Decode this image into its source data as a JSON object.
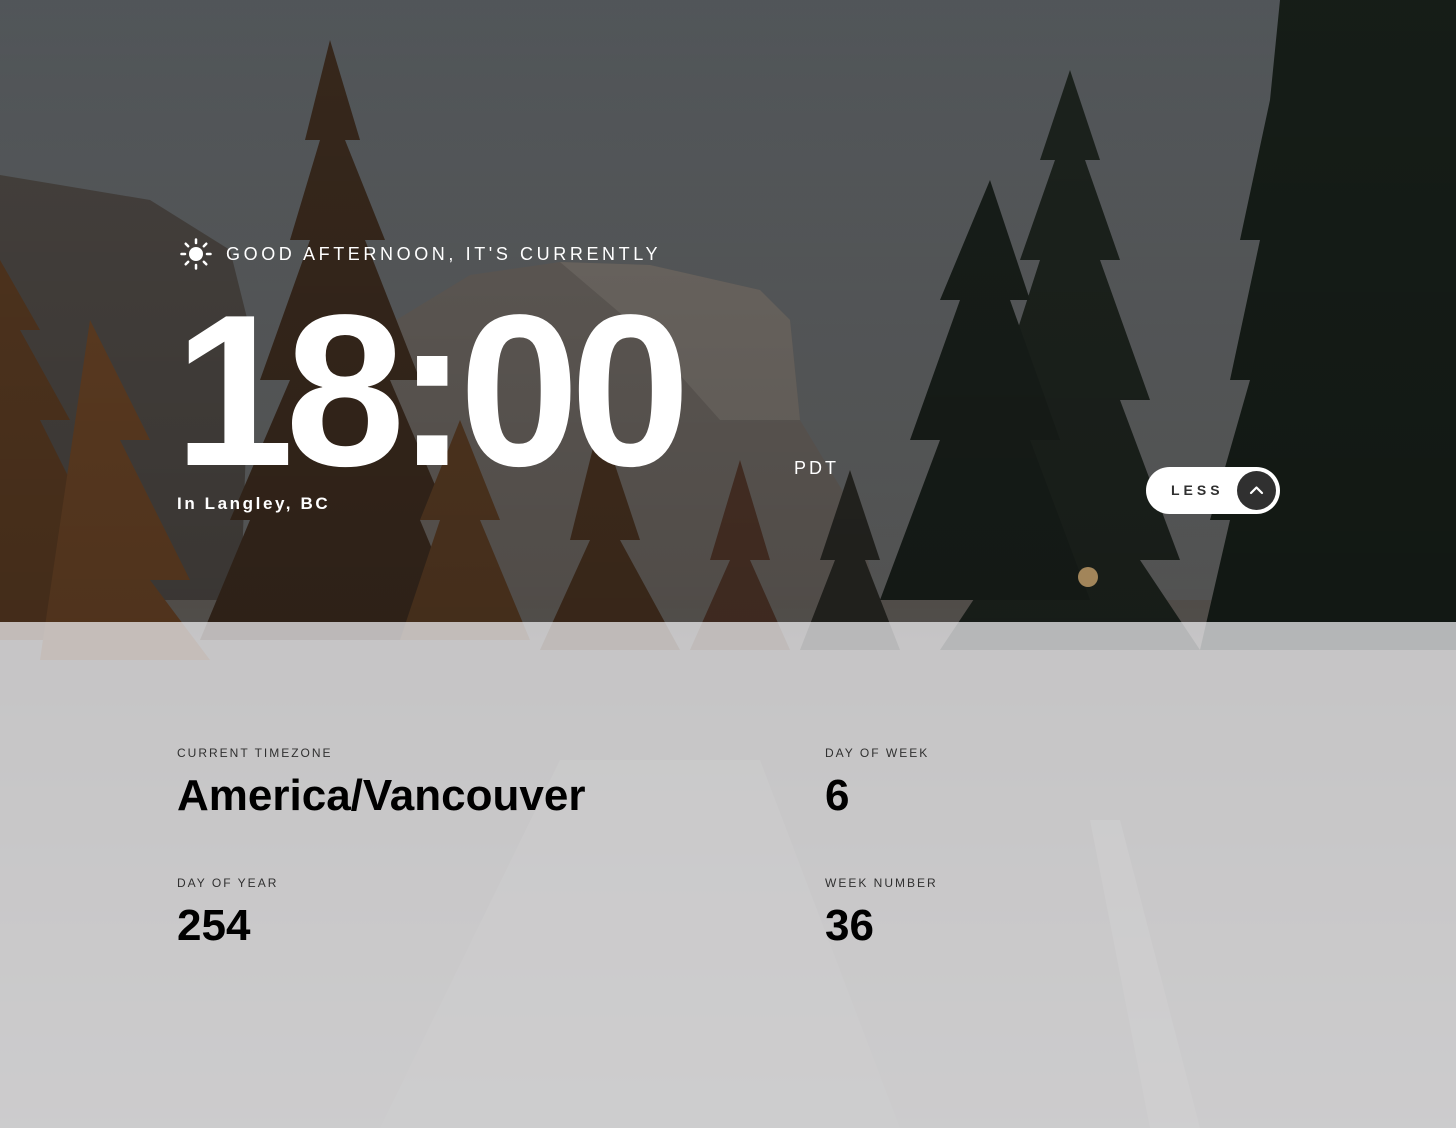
{
  "colors": {
    "text_light": "#ffffff",
    "text_dark": "#000000",
    "button_bg": "#ffffff",
    "button_icon_bg": "#303030",
    "panel_bg": "#dcdcde"
  },
  "greeting": {
    "icon": "sun-icon",
    "text": "GOOD AFTERNOON, IT'S CURRENTLY"
  },
  "clock": {
    "time": "18:00",
    "abbreviation": "PDT",
    "location": "In Langley, BC"
  },
  "toggle": {
    "label": "LESS",
    "icon": "chevron-up-icon"
  },
  "details": {
    "timezone": {
      "label": "CURRENT TIMEZONE",
      "value": "America/Vancouver"
    },
    "day_of_year": {
      "label": "DAY OF YEAR",
      "value": "254"
    },
    "day_of_week": {
      "label": "DAY OF WEEK",
      "value": "6"
    },
    "week_number": {
      "label": "WEEK NUMBER",
      "value": "36"
    }
  }
}
